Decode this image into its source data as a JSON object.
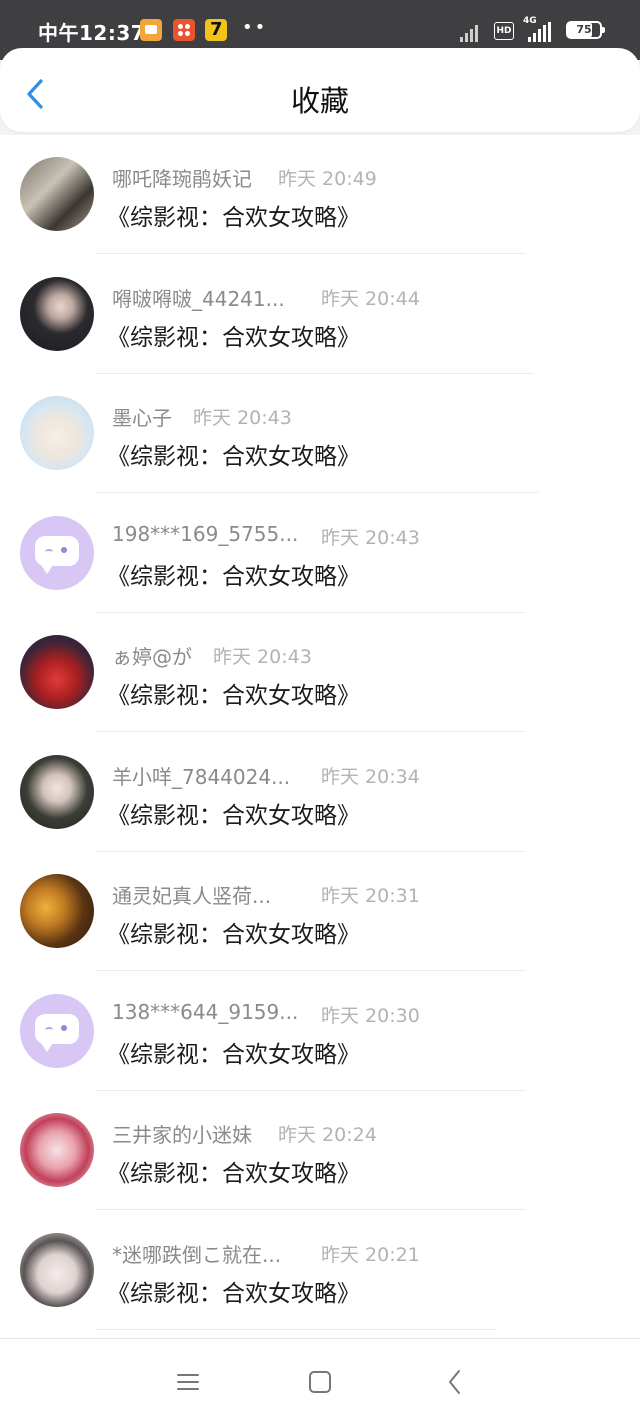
{
  "status_bar": {
    "time": "中午12:37",
    "network": "4G",
    "hd": "HD",
    "battery": "75",
    "battery_fraction": 0.75,
    "notification_icons": [
      "note-app-icon",
      "kuaikan-app-icon",
      "qimao-app-icon"
    ],
    "more": "••"
  },
  "header": {
    "title": "收藏",
    "back_icon": "chevron-left-icon",
    "accent_color": "#2f8ee8"
  },
  "items": [
    {
      "username": "哪吒降琬鹃妖记",
      "time": "昨天 20:49",
      "book": "《综影视：合欢女攻略》",
      "avatar": "photo"
    },
    {
      "username": "嘚啵嘚啵_44241...",
      "time": "昨天 20:44",
      "book": "《综影视：合欢女攻略》",
      "avatar": "photo"
    },
    {
      "username": "墨心子",
      "time": "昨天 20:43",
      "book": "《综影视：合欢女攻略》",
      "avatar": "photo"
    },
    {
      "username": "198***169_5755...",
      "time": "昨天 20:43",
      "book": "《综影视：合欢女攻略》",
      "avatar": "default"
    },
    {
      "username": "ぁ婷@が",
      "time": "昨天 20:43",
      "book": "《综影视：合欢女攻略》",
      "avatar": "photo"
    },
    {
      "username": "羊小咩_7844024...",
      "time": "昨天 20:34",
      "book": "《综影视：合欢女攻略》",
      "avatar": "photo"
    },
    {
      "username": "通灵妃真人竖荷...",
      "time": "昨天 20:31",
      "book": "《综影视：合欢女攻略》",
      "avatar": "photo"
    },
    {
      "username": "138***644_9159...",
      "time": "昨天 20:30",
      "book": "《综影视：合欢女攻略》",
      "avatar": "default"
    },
    {
      "username": "三井家的小迷妹",
      "time": "昨天 20:24",
      "book": "《综影视：合欢女攻略》",
      "avatar": "photo"
    },
    {
      "username": "*迷哪跌倒こ就在...",
      "time": "昨天 20:21",
      "book": "《综影视：合欢女攻略》",
      "avatar": "photo"
    }
  ],
  "nav_bar": {
    "icons": [
      "menu-icon",
      "home-square-icon",
      "back-triangle-icon"
    ]
  }
}
